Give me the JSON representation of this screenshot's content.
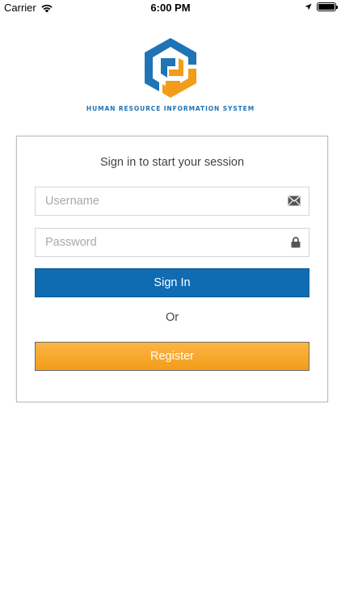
{
  "status_bar": {
    "carrier": "Carrier",
    "time": "6:00 PM"
  },
  "branding": {
    "tagline": "HUMAN RESOURCE INFORMATION SYSTEM",
    "colors": {
      "blue": "#1f74b6",
      "orange": "#f39c1a"
    }
  },
  "login": {
    "heading": "Sign in to start your session",
    "username": {
      "placeholder": "Username",
      "value": "",
      "icon": "envelope-icon"
    },
    "password": {
      "placeholder": "Password",
      "value": "",
      "icon": "lock-icon"
    },
    "signin_label": "Sign In",
    "or_label": "Or",
    "register_label": "Register"
  },
  "colors": {
    "signin_button": "#0f6cb3",
    "register_button": "#f39c1a"
  }
}
